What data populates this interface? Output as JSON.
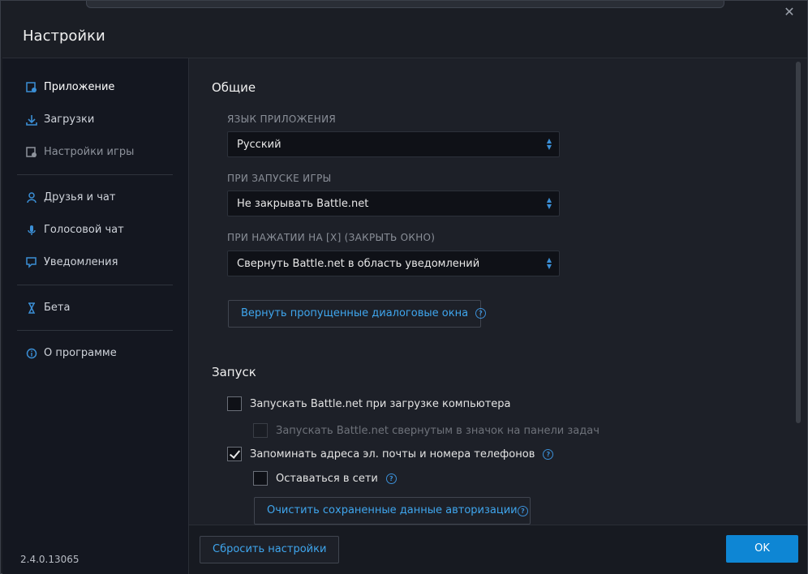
{
  "window": {
    "title": "Настройки",
    "close_symbol": "✕"
  },
  "sidebar": {
    "items": [
      {
        "label": "Приложение",
        "icon": "app-settings-icon",
        "active": true
      },
      {
        "label": "Загрузки",
        "icon": "download-icon"
      },
      {
        "label": "Настройки игры",
        "icon": "game-settings-icon",
        "dim": true
      },
      {
        "label": "Друзья и чат",
        "icon": "friends-icon"
      },
      {
        "label": "Голосовой чат",
        "icon": "microphone-icon"
      },
      {
        "label": "Уведомления",
        "icon": "notification-icon"
      },
      {
        "label": "Бета",
        "icon": "flask-icon"
      },
      {
        "label": "О программе",
        "icon": "info-icon"
      }
    ],
    "version": "2.4.0.13065"
  },
  "general": {
    "heading": "Общие",
    "language_label": "ЯЗЫК ПРИЛОЖЕНИЯ",
    "language_value": "Русский",
    "on_launch_label": "ПРИ ЗАПУСКЕ ИГРЫ",
    "on_launch_value": "Не закрывать Battle.net",
    "on_close_label": "ПРИ НАЖАТИИ НА [X] (ЗАКРЫТЬ ОКНО)",
    "on_close_value": "Свернуть Battle.net в область уведомлений",
    "restore_dialogs_button": "Вернуть пропущенные диалоговые окна",
    "help_symbol": "?"
  },
  "startup": {
    "heading": "Запуск",
    "start_with_pc": "Запускать Battle.net при загрузке компьютера",
    "start_minimized": "Запускать Battle.net свернутым в значок на панели задач",
    "remember_emails": "Запоминать адреса эл. почты и номера телефонов",
    "stay_online": "Оставаться в сети",
    "clear_auth_button": "Очистить сохраненные данные авторизации"
  },
  "footer": {
    "reset_button": "Сбросить настройки",
    "ok_button": "OK"
  },
  "colors": {
    "accent": "#0e86d4",
    "link": "#3fa6ee",
    "background": "#1d2028"
  }
}
